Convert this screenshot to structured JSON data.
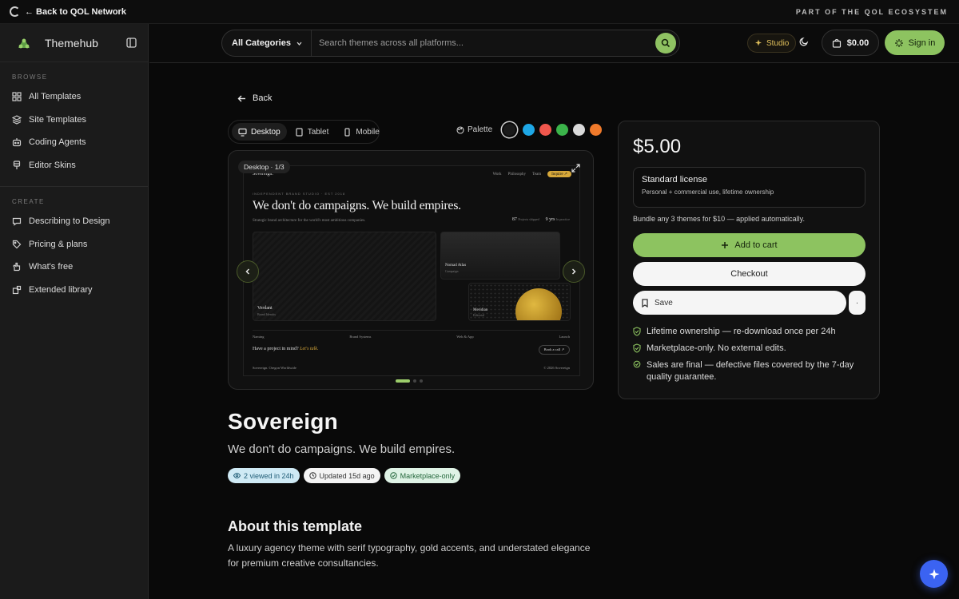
{
  "network_bar": {
    "back_label": "← Back to QOL Network",
    "right_label": "PART OF THE QOL ECOSYSTEM"
  },
  "sidebar": {
    "brand": "Themehub",
    "browse_label": "BROWSE",
    "browse_items": [
      {
        "label": "All Templates",
        "icon": "grid-icon"
      },
      {
        "label": "Site Templates",
        "icon": "layers-icon"
      },
      {
        "label": "Coding Agents",
        "icon": "bot-icon"
      },
      {
        "label": "Editor Skins",
        "icon": "brush-icon"
      }
    ],
    "create_label": "CREATE",
    "create_items": [
      {
        "label": "Describing to Design",
        "icon": "chat-icon"
      },
      {
        "label": "Pricing & plans",
        "icon": "tag-icon"
      },
      {
        "label": "What's free",
        "icon": "hand-icon"
      },
      {
        "label": "Extended library",
        "icon": "library-icon"
      }
    ]
  },
  "header": {
    "category": "All Categories",
    "search_placeholder": "Search themes across all platforms...",
    "studio_label": "Studio",
    "cart_total": "$0.00",
    "signin_label": "Sign in"
  },
  "main": {
    "back_label": "Back",
    "device_tabs": [
      {
        "label": "Desktop",
        "active": true
      },
      {
        "label": "Tablet",
        "active": false
      },
      {
        "label": "Mobile",
        "active": false
      }
    ],
    "palette_label": "Palette",
    "palette_colors": [
      "#1a1a1a",
      "#1ea7e6",
      "#f0574d",
      "#3bb34a",
      "#d9d9d9",
      "#f07a2b"
    ],
    "preview_badge": "Desktop · 1/3",
    "preview_dots": {
      "count": 3,
      "active": 1
    },
    "mini": {
      "brand": "Sovereign.",
      "nav_links": [
        "Work",
        "Philosophy",
        "Team"
      ],
      "nav_cta": "Inquire ↗",
      "eyebrow": "INDEPENDENT BRAND STUDIO · EST 2018",
      "headline": "We don't do campaigns. We build empires.",
      "sub": "Strategic brand architecture for the world's most ambitious companies.",
      "stat1_num": "87",
      "stat1_label": "Projects shipped",
      "stat2_num": "9 yrs",
      "stat2_label": "In practice",
      "card1_title": "Verdant",
      "card1_sub": "Brand Identity",
      "card2_title": "Nomad Atlas",
      "card2_sub": "Campaign",
      "card3_title": "Meridian",
      "card3_sub": "Editorial",
      "services": [
        "Naming",
        "Brand Systems",
        "Web & App",
        "Launch"
      ],
      "callout": "Have a project in mind?",
      "callout_em": "Let's talk.",
      "book": "Book a call ↗",
      "footer_left": "Sovereign. Oregon Worldwide",
      "footer_right": "© 2026 Sovereign"
    },
    "title": "Sovereign",
    "tagline": "We don't do campaigns. We build empires.",
    "chips": {
      "views": "2 viewed in 24h",
      "updated": "Updated 15d ago",
      "market": "Marketplace-only"
    },
    "about_heading": "About this template",
    "about_text": "A luxury agency theme with serif typography, gold accents, and understated elegance for premium creative consultancies."
  },
  "panel": {
    "price": "$5.00",
    "license_name": "Standard license",
    "license_desc": "Personal + commercial use, lifetime ownership",
    "bundle": "Bundle any 3 themes for $10 — applied automatically.",
    "add_to_cart": "Add to cart",
    "checkout": "Checkout",
    "save": "Save",
    "more": "·",
    "features": [
      "Lifetime ownership — re-download once per 24h",
      "Marketplace-only. No external edits.",
      "Sales are final — defective files covered by the 7-day quality guarantee."
    ]
  },
  "colors": {
    "accent": "#8dc360",
    "studio": "#e2c15c",
    "fab": "#3b63f2"
  }
}
